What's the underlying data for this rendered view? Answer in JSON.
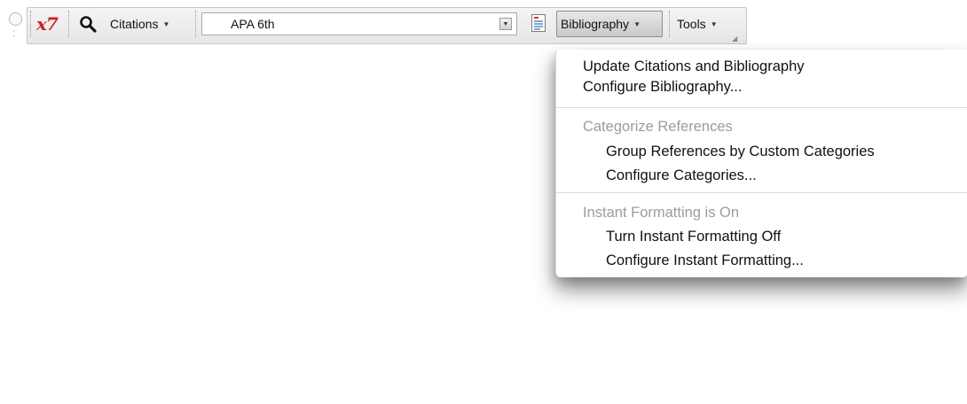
{
  "toolbar": {
    "logo": "x7",
    "citations_label": "Citations",
    "style_value": "APA 6th",
    "bibliography_label": "Bibliography",
    "tools_label": "Tools",
    "dropdown_arrow": "▼"
  },
  "icons": [
    "grip-icon",
    "endnote-x7-icon",
    "search-icon",
    "dropdown-arrow-icon",
    "bibliography-doc-icon",
    "resize-corner-icon"
  ],
  "menu": {
    "items": [
      {
        "label": "Update Citations and Bibliography",
        "enabled": true
      },
      {
        "label": "Configure Bibliography...",
        "enabled": true
      }
    ],
    "categorize": {
      "heading": "Categorize References",
      "items": [
        {
          "label": "Group References by Custom Categories",
          "enabled": true
        },
        {
          "label": "Configure Categories...",
          "enabled": true
        }
      ]
    },
    "instant": {
      "heading": "Instant Formatting is On",
      "items": [
        {
          "label": "Turn Instant Formatting Off",
          "enabled": true
        },
        {
          "label": "Configure Instant Formatting...",
          "enabled": true
        }
      ]
    }
  },
  "colors": {
    "logo_red": "#d22020",
    "heading_gray": "#9c9c9c",
    "doc_icon_red": "#c0392b"
  }
}
